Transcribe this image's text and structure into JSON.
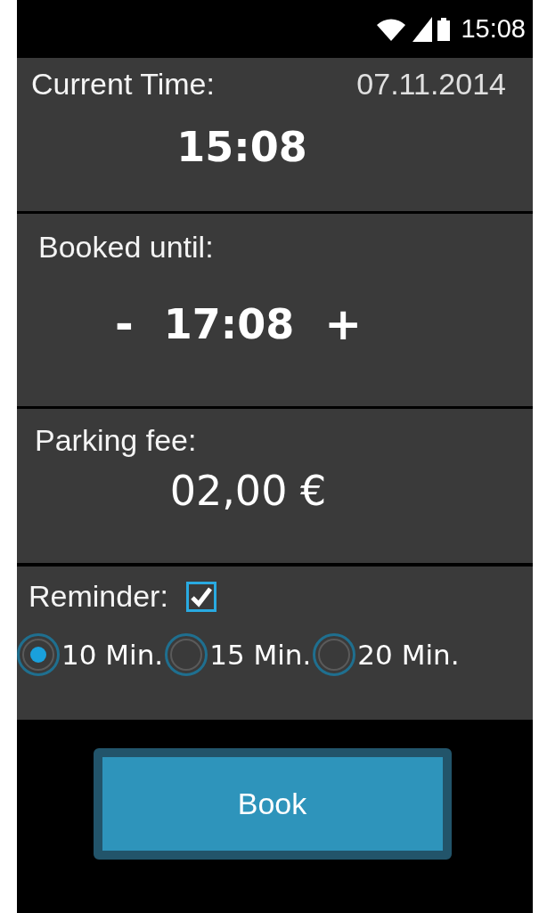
{
  "status_bar": {
    "time": "15:08"
  },
  "current_time": {
    "label": "Current Time:",
    "date": "07.11.2014",
    "time": "15:08"
  },
  "booked_until": {
    "label": "Booked until:",
    "decrease": "-",
    "time": "17:08",
    "increase": "+"
  },
  "parking_fee": {
    "label": "Parking fee:",
    "amount": "02,00 €"
  },
  "reminder": {
    "label": "Reminder:",
    "checked": true,
    "options": [
      {
        "label": "10 Min.",
        "selected": true
      },
      {
        "label": "15 Min.",
        "selected": false
      },
      {
        "label": "20 Min.",
        "selected": false
      }
    ]
  },
  "buttons": [
    {
      "label": "Book"
    }
  ]
}
